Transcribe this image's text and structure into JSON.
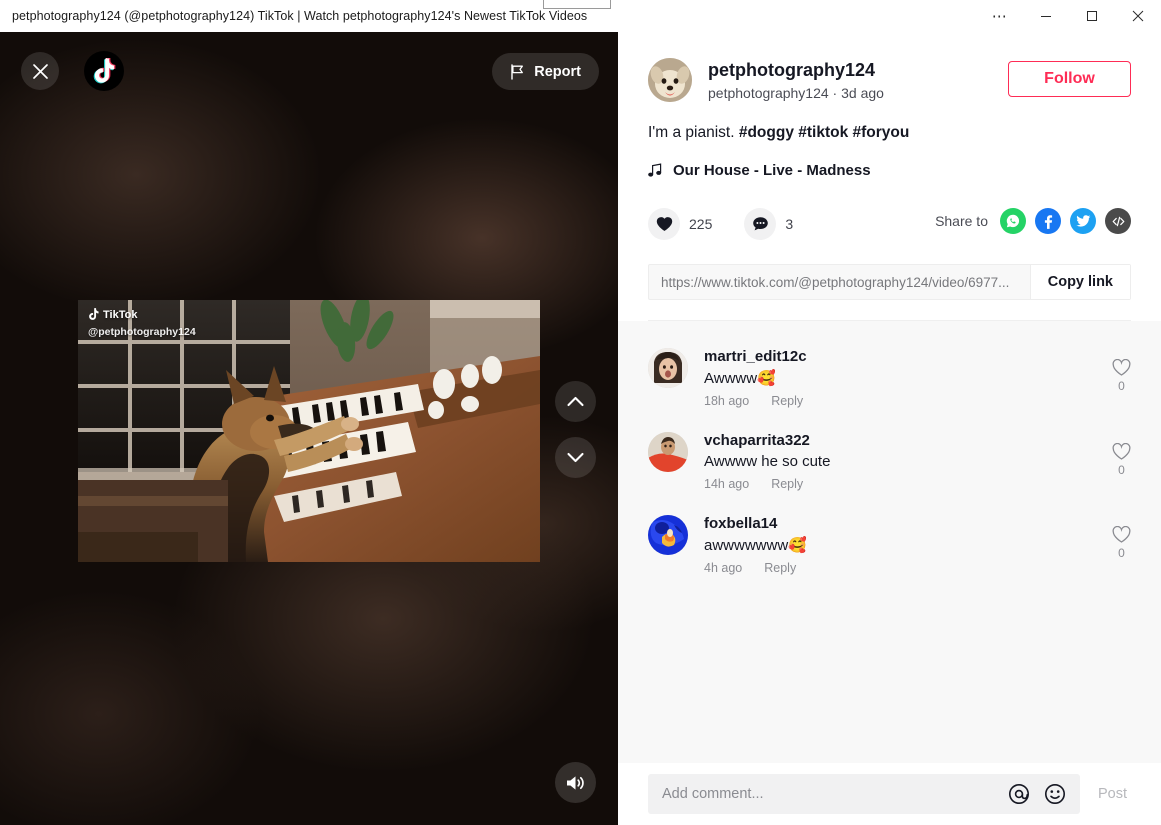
{
  "window": {
    "title": "petphotography124 (@petphotography124) TikTok | Watch petphotography124's Newest TikTok Videos",
    "controls": {
      "more": "⋯",
      "minimize": "minimize",
      "maximize": "maximize",
      "close": "close"
    }
  },
  "video_stage": {
    "close_label": "Close",
    "brand": "TikTok",
    "report_label": "Report",
    "watermark_brand": "TikTok",
    "watermark_handle": "@petphotography124",
    "nav_prev": "Previous video",
    "nav_next": "Next video",
    "volume_label": "Volume"
  },
  "post": {
    "author_name": "petphotography124",
    "author_sub": "petphotography124 · 3d ago",
    "follow_label": "Follow",
    "caption_text": "I'm a pianist. ",
    "caption_tags": "#doggy #tiktok #foryou",
    "music_title": "Our House - Live - Madness",
    "like_count": "225",
    "comment_count": "3",
    "share_label": "Share to",
    "share_targets": [
      "whatsapp",
      "facebook",
      "twitter",
      "embed"
    ],
    "link_url": "https://www.tiktok.com/@petphotography124/video/6977...",
    "copy_label": "Copy link"
  },
  "comments": [
    {
      "user": "martri_edit12c",
      "text": "Awwww🥰",
      "time": "18h ago",
      "reply": "Reply",
      "likes": "0"
    },
    {
      "user": "vchaparrita322",
      "text": "Awwww he so cute",
      "time": "14h ago",
      "reply": "Reply",
      "likes": "0"
    },
    {
      "user": "foxbella14",
      "text": "awwwwwww🥰",
      "time": "4h ago",
      "reply": "Reply",
      "likes": "0"
    }
  ],
  "composer": {
    "placeholder": "Add comment...",
    "mention_icon": "at-icon",
    "emoji_icon": "emoji-icon",
    "post_label": "Post"
  },
  "colors": {
    "accent": "#fe2c55",
    "whatsapp": "#25d366",
    "facebook": "#1877f2",
    "twitter": "#1da1f2",
    "embed": "#4a4a4a"
  }
}
